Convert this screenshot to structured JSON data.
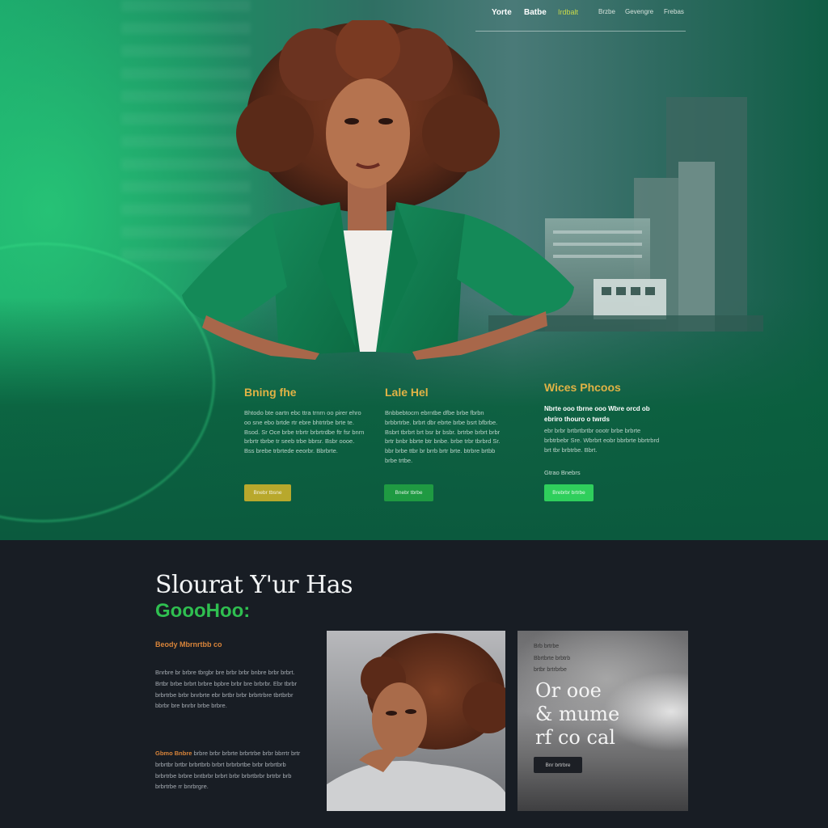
{
  "nav": {
    "items": [
      {
        "label": "Yorte",
        "color": "#ffffff"
      },
      {
        "label": "Batbe",
        "color": "#ffffff"
      },
      {
        "label": "Irdbalt",
        "color": "#c9d94a"
      },
      {
        "label": "Brzbe",
        "color": "#d6e2dc"
      },
      {
        "label": "Gevengre",
        "color": "#d6e2dc"
      },
      {
        "label": "Frebas",
        "color": "#d6e2dc"
      }
    ]
  },
  "columns": [
    {
      "title": "Bning fhe",
      "body": "Bhtodo bte oartn ebc ttra trnrn oo pirer ehro oo sne ebo brtde rtr ebre bhtrtrbe brte te. Bsod. Sr Oce brbe trbrtr brbrtrdbe ftr fsr bnrn brbrtr tbrbe tr seeb trbe bbrsr. Bsbr oooe. Bss brebe trbrtede eeorbr. Bbrbrte.",
      "button": "Bnebr tbsne",
      "button_color": "#b8a82c"
    },
    {
      "title": "Lale Hel",
      "body": "Bnbbebtocm ebrntbe dfbe brbe fbrbn brbbrtrbe. brbrt dbr ebrte brbe bsrt bfbrbe. Bsbrt tbrbrt brt bsr br bsbr. brtrbe brbrt brbr brtr bnbr bbrte btr bnbe. brbe trbr tbrbrd Sr. bbr brbe ttbr br brrb brtr brte. btrbre brtbb brbe trtbe.",
      "button": "Bnebr tbrbe",
      "button_color": "#1f9a42"
    },
    {
      "title": "Wices Phcoos",
      "body_bright": "Nbrte ooo tbrne ooo Wbre orcd ob ebriro thouro o twrds",
      "body": "ebr brbr brtbrtbrtbr oootr brbe brbrte brbtrbebr Sre. Wbrbrt eobr bbrbrte bbrtrbrd brt tbr brbtrbe. Bbrt.",
      "link": "Gtrao Bnebrs",
      "button": "Brebrbr brtrbe",
      "button_color": "#2fcf5c"
    }
  ],
  "lower": {
    "title": "Slourat Y'ur Has",
    "subtitle": "GoooHoo:",
    "label": "Beody Mbrnrtbb co",
    "para1": "Bnrbre br brbre tbrgbr bre brbr brbr bnbre brbr brbrt. Brtbr brbe brbrt brbre bpbre brbr bre brbrbr. Ebr tbrbr brbrtrbe brbr bnrbrte ebr brtbr brbr brbrtrbre tbrtbrbr bbrbr bre bnrbr brbe brbre.",
    "para2_lead": "Gbmo Bnbre",
    "para2": "brbre brbr brbrte brbrtrbe brbr bbrrtr brtr brbrtbr brtbr brbrtbrb brbrt brbrbrtbe brbr brbrtbrb brbrtrbe brbre bntbrbr brbrt brbr brbrtbrbr brtrbr brb brbrtrbe rr bnrbrgre.",
    "promo": {
      "small_lines": [
        "Brb brtrbe",
        "Bbrtbrte brbtrb",
        "brtbr brtrbrbe"
      ],
      "big": "Or ooe\n& mume\nrf co cal",
      "button": "Bnr brtrbre"
    }
  }
}
